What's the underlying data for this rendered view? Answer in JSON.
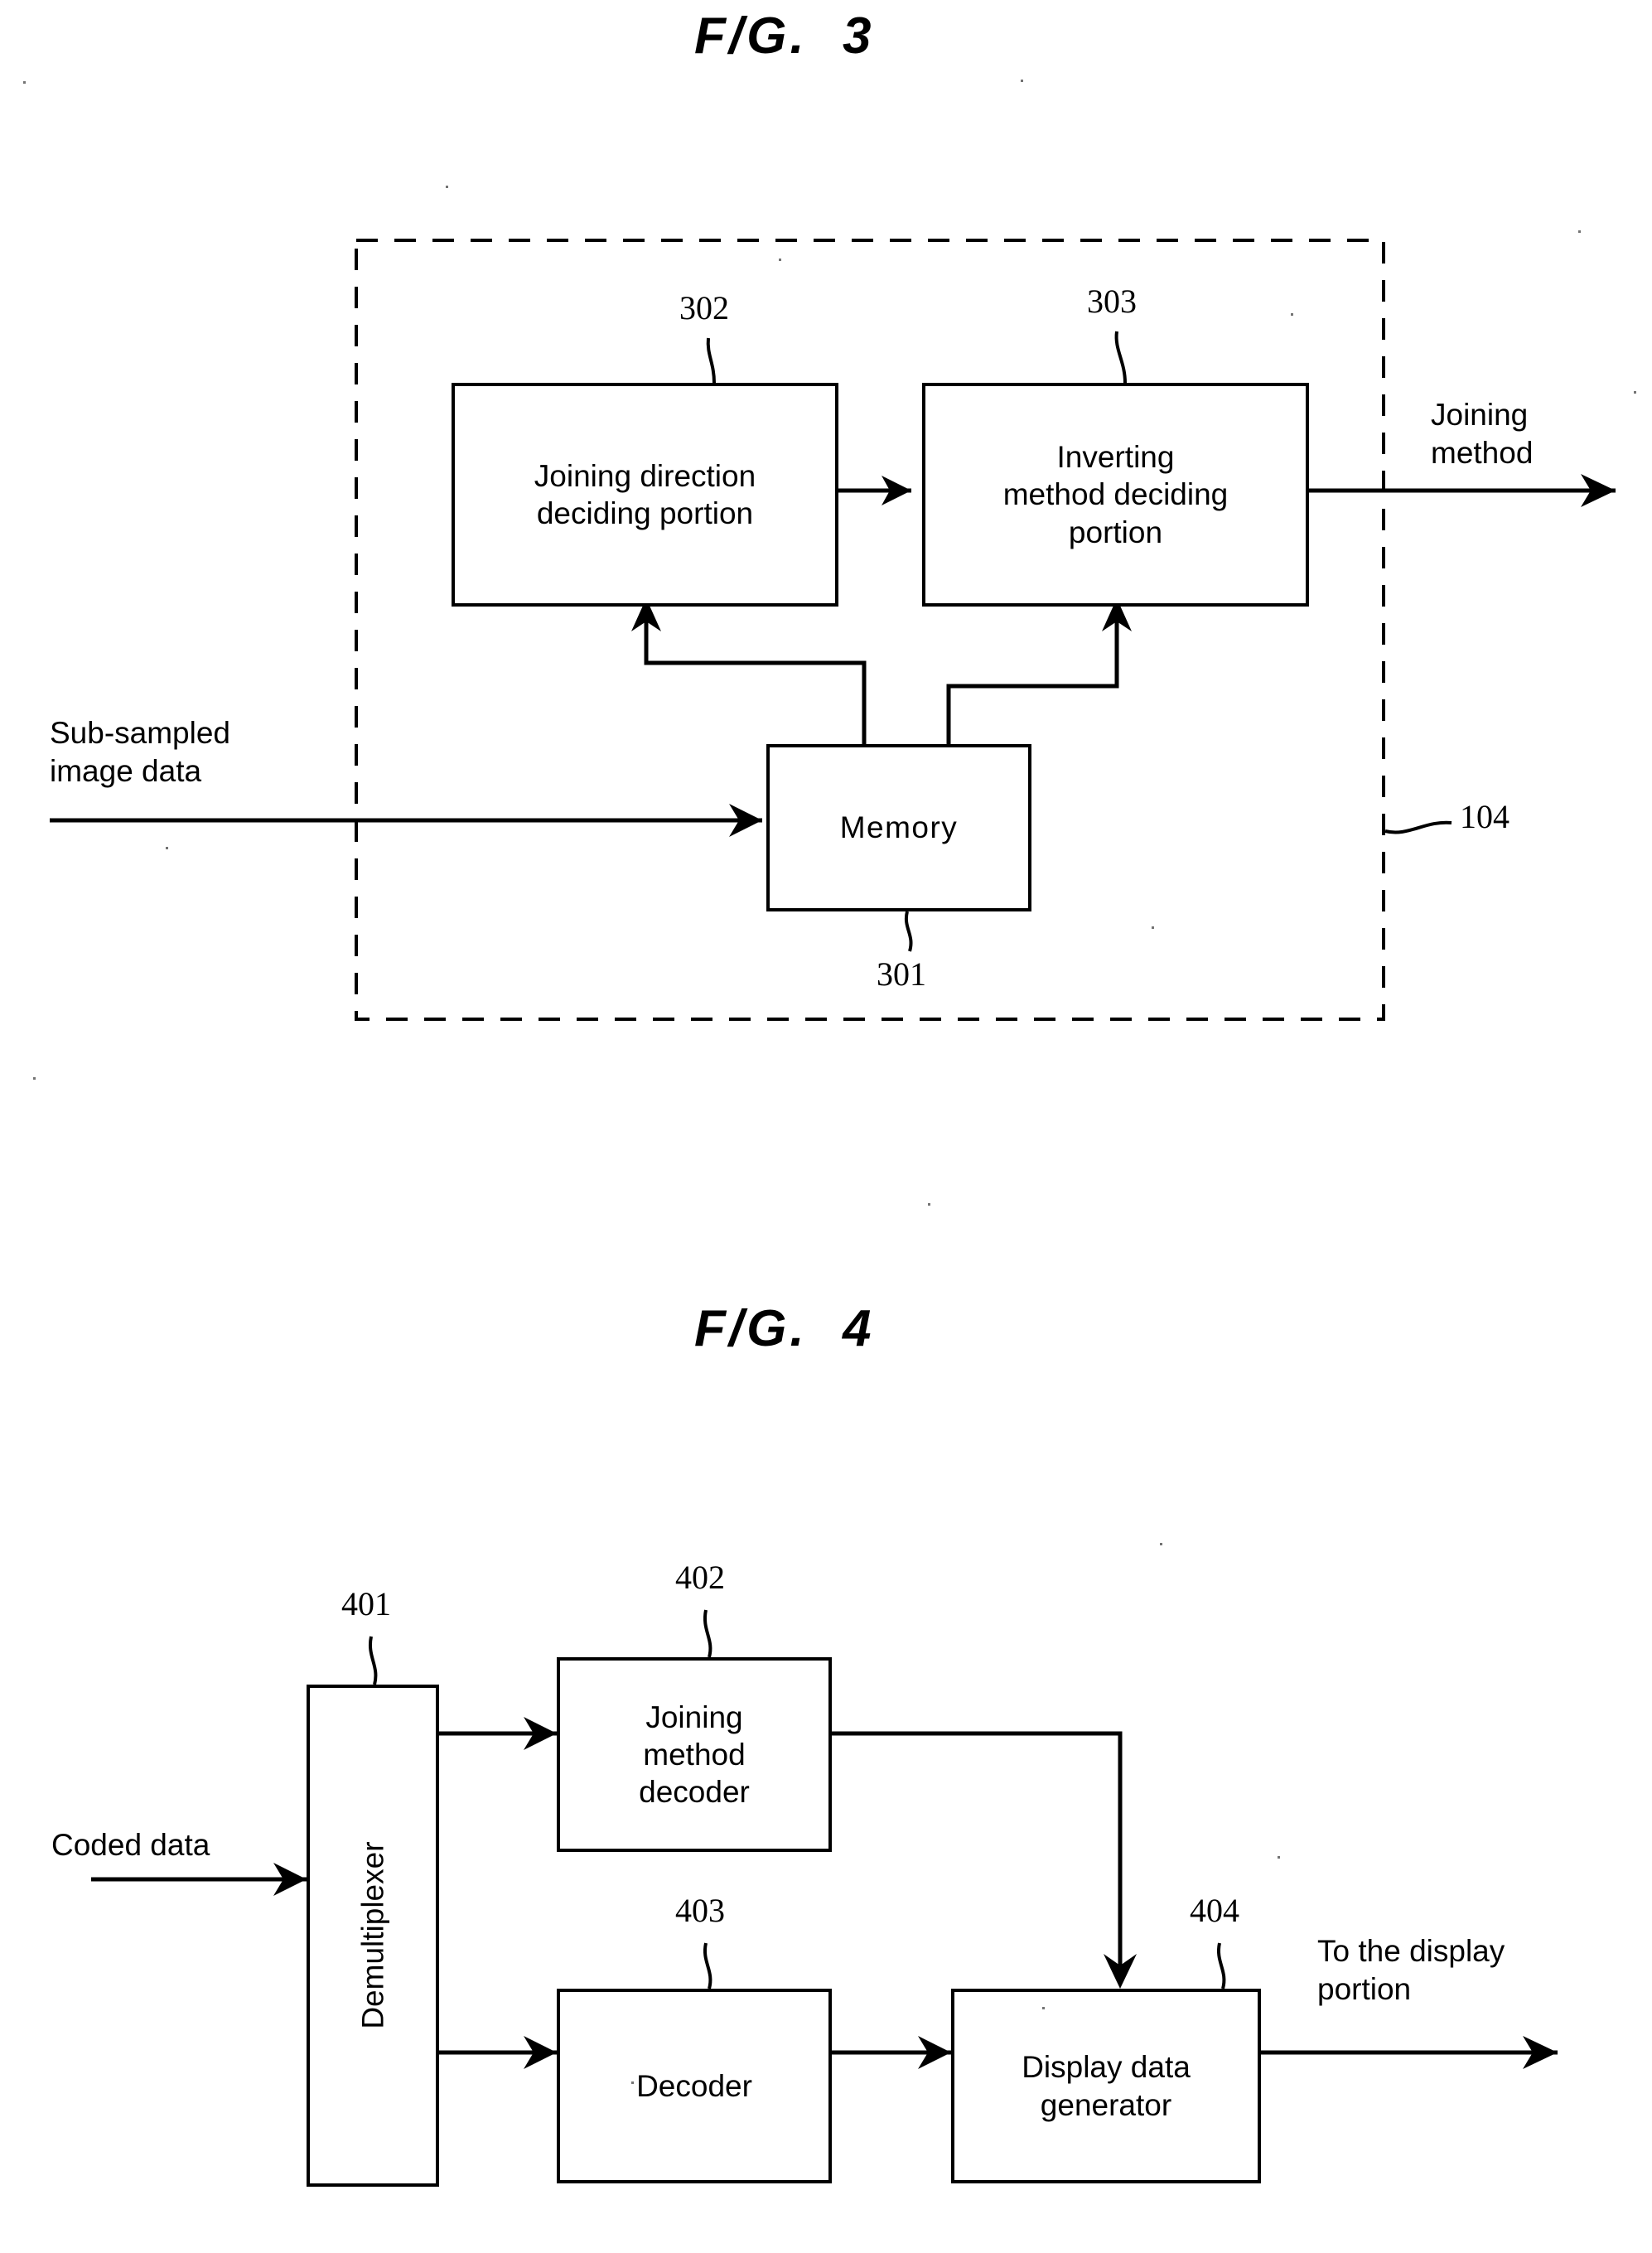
{
  "figures": [
    {
      "id": "fig3",
      "title": "F/G.  3",
      "boundary_ref": "104",
      "inputs": [
        {
          "name": "sub-sampled-image-data",
          "label": "Sub-sampled\nimage data"
        }
      ],
      "outputs": [
        {
          "name": "joining-method-output",
          "label": "Joining\nmethod"
        }
      ],
      "blocks": [
        {
          "name": "joining-direction-deciding-portion",
          "ref": "302",
          "label": "Joining direction\ndeciding portion"
        },
        {
          "name": "inverting-method-deciding-portion",
          "ref": "303",
          "label": "Inverting\nmethod deciding\nportion"
        },
        {
          "name": "memory",
          "ref": "301",
          "label": "Memory"
        }
      ]
    },
    {
      "id": "fig4",
      "title": "F/G.  4",
      "inputs": [
        {
          "name": "coded-data",
          "label": "Coded data"
        }
      ],
      "outputs": [
        {
          "name": "to-the-display-portion",
          "label": "To the display\nportion"
        }
      ],
      "blocks": [
        {
          "name": "demultiplexer",
          "ref": "401",
          "label": "Demultiplexer"
        },
        {
          "name": "joining-method-decoder",
          "ref": "402",
          "label": "Joining\nmethod\ndecoder"
        },
        {
          "name": "decoder",
          "ref": "403",
          "label": "Decoder"
        },
        {
          "name": "display-data-generator",
          "ref": "404",
          "label": "Display data\ngenerator"
        }
      ]
    }
  ]
}
